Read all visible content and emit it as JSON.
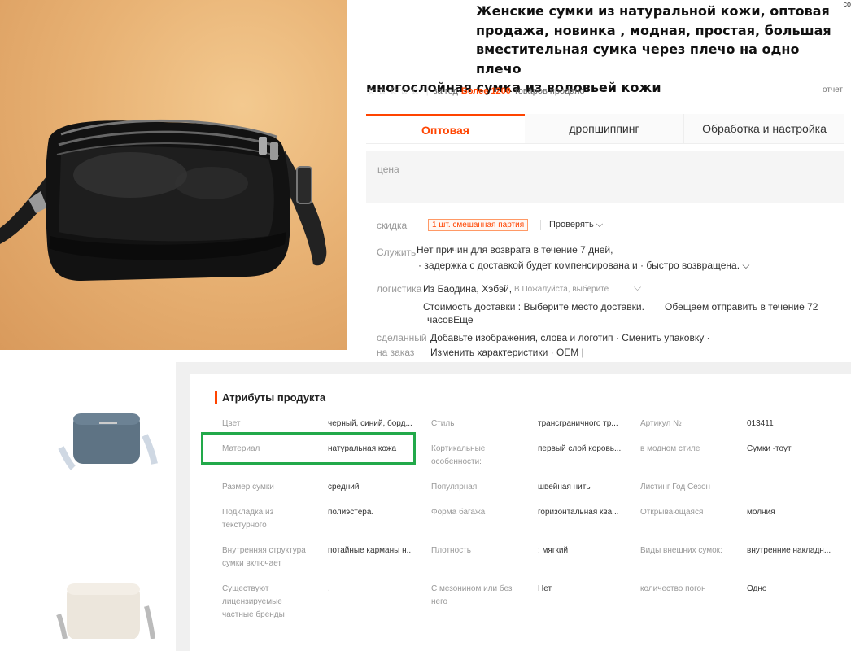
{
  "product": {
    "title_line1": "Женские сумки из натуральной кожи, оптовая",
    "title_line2": "продажа, новинка          , модная, простая, большая",
    "title_line3": "вместительная сумка через плечо на одно плечо",
    "title_line4": "многослойная сумка из воловьей кожи",
    "corner_text": "co"
  },
  "rating": {
    "stars": "☆☆☆☆☆",
    "prefix": "за год",
    "hot": "Более 1200",
    "suffix": "товаров продано",
    "report": "отчет"
  },
  "tabs": [
    "Оптовая",
    "дропшиппинг",
    "Обработка и настройка"
  ],
  "price": {
    "label": "цена"
  },
  "discount": {
    "label": "скидка",
    "badge": "1 шт. смешанная партия",
    "check": "Проверять ⌵"
  },
  "service": {
    "label": "Служить",
    "line1": "Нет причин для возврата в течение 7 дней,",
    "line2": "· задержка с доставкой будет компенсирована и · быстро возвращена. ⌵"
  },
  "logistics": {
    "label": "логистика",
    "from": "Из Баодина, Хэбэй,",
    "choose": "В Пожалуйста, выберите",
    "cost": "Стоимость доставки : Выберите место доставки.",
    "promise": "Обещаем отправить в течение 72",
    "hours": "часовЕще"
  },
  "custom": {
    "label1": "сделанный",
    "label2": "на заказ",
    "line1": "Добавьте изображения, слова и логотип   · Сменить упаковку   ·",
    "line2": "Изменить характеристики   · OEM   |"
  },
  "attributes": {
    "title": "Атрибуты продукта",
    "rows": [
      [
        "Цвет",
        "черный, синий, борд...",
        "Стиль",
        "трансграничного тр...",
        "Артикул №",
        "013411"
      ],
      [
        "Материал",
        "натуральная кожа",
        "Кортикальные особенности:",
        "первый слой коровь...",
        "в модном стиле",
        "Сумки -тоут"
      ],
      [
        "Размер сумки",
        "средний",
        "Популярная",
        "швейная нить",
        "Листинг Год Сезон",
        ""
      ],
      [
        "Подкладка из текстурного",
        "полиэстера.",
        "Форма багажа",
        "горизонтальная ква...",
        "Открывающаяся",
        "молния"
      ],
      [
        "Внутренняя структура сумки включает",
        "потайные карманы н...",
        "Плотность",
        ": мягкий",
        "Виды внешних сумок:",
        "внутренние накладн..."
      ],
      [
        "Существуют лицензируемые частные бренды",
        ",",
        "С мезонином или без него",
        "Нет",
        "количество погон",
        "Одно"
      ]
    ]
  }
}
